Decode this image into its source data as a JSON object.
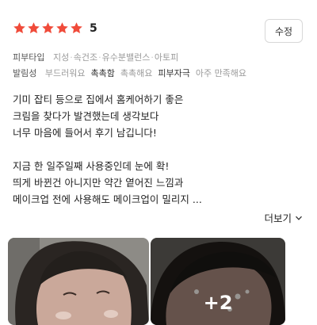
{
  "review": {
    "rating": 5,
    "rating_text": "5",
    "edit_label": "수정",
    "star_color": "#f04b3a"
  },
  "skin_type": {
    "label": "피부타입",
    "values": [
      "지성",
      "속건조",
      "유수분밸런스",
      "아토피"
    ]
  },
  "spreadability": {
    "label": "발림성",
    "options": [
      {
        "text": "부드러워요",
        "selected": false
      },
      {
        "text": "촉촉함",
        "selected": true
      },
      {
        "text": "촉촉해요",
        "selected": false
      },
      {
        "text": "피부자극",
        "selected": true
      },
      {
        "text": "아주 만족해요",
        "selected": false
      }
    ]
  },
  "body_lines": [
    "기미 잡티 등으로 집에서 홈케어하기 좋은",
    " 크림을 찾다가 발견했는데 생각보다",
    "너무 마음에 들어서 후기 남깁니다!",
    "",
    "지금 한 일주일째 사용중인데 눈에 확!",
    "띄게 바뀐건 아니지만 약간 옅어진 느낌과",
    "메이크업 전에 사용해도 메이크업이 밀리지 ..."
  ],
  "more_label": "더보기",
  "photos": {
    "extra_count": "+2"
  }
}
